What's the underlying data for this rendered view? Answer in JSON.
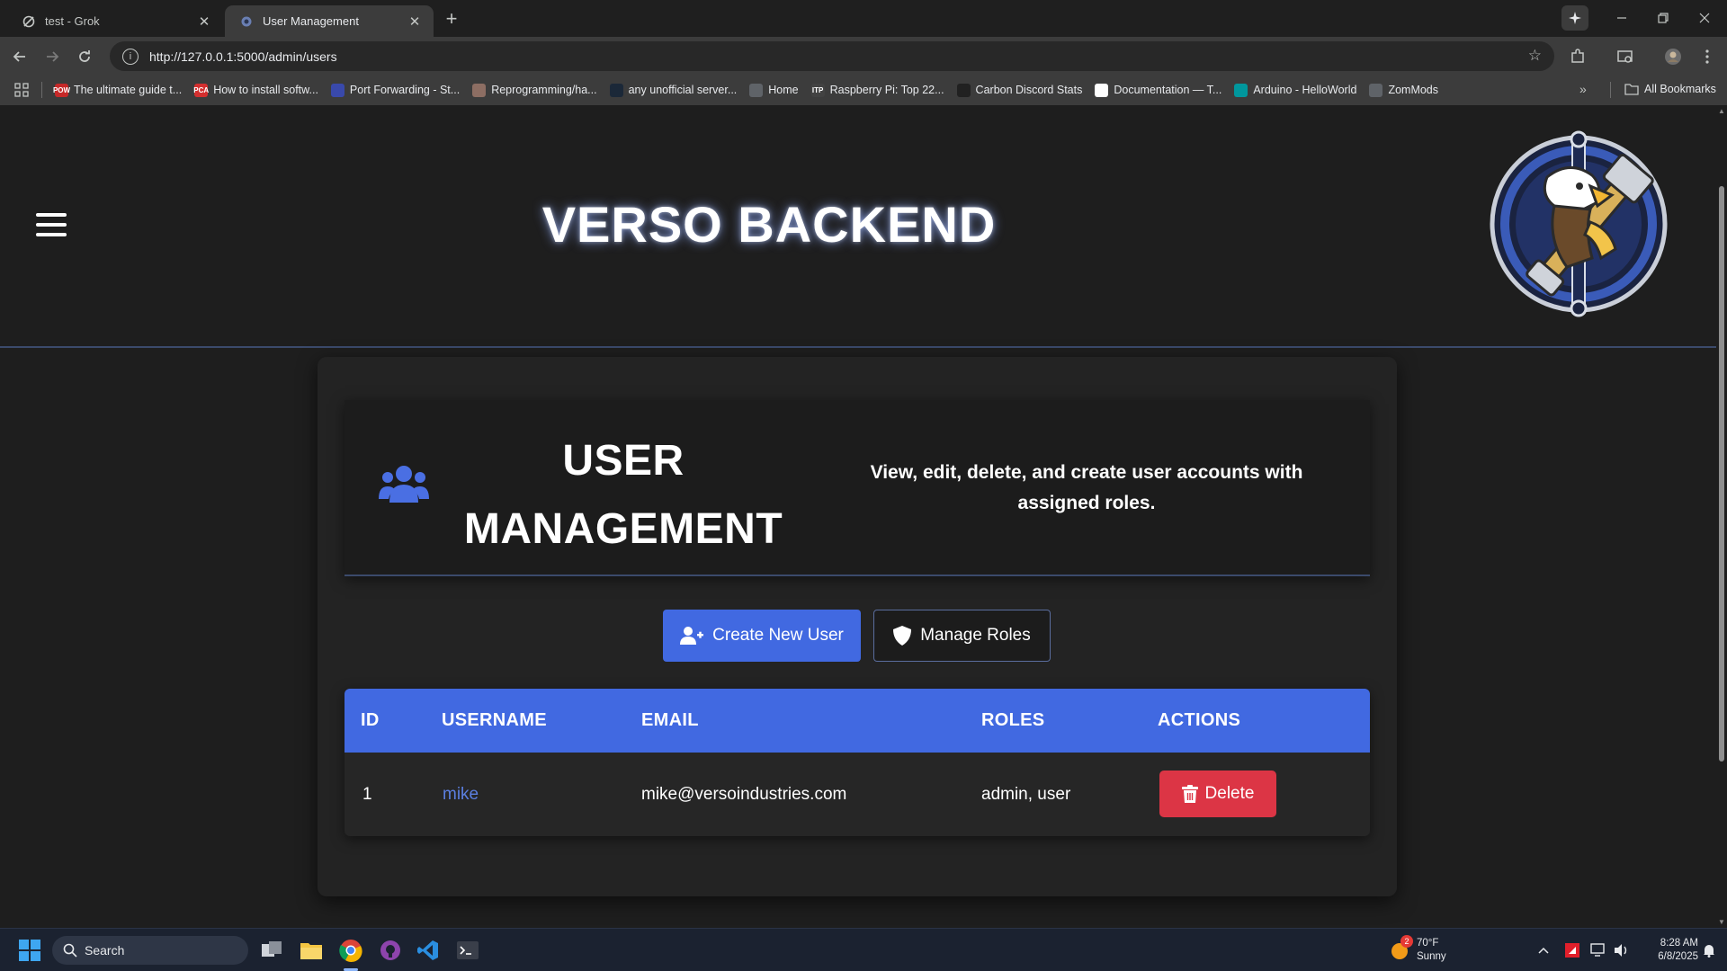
{
  "browser": {
    "tabs": [
      {
        "label": "test - Grok",
        "active": false
      },
      {
        "label": "User Management",
        "active": true
      }
    ],
    "new_tab_label": "+",
    "url": "http://127.0.0.1:5000/admin/users",
    "bookmarks": [
      {
        "label": "The ultimate guide t...",
        "badge": "POW",
        "color": "#c62828"
      },
      {
        "label": "How to install softw...",
        "badge": "PCA",
        "color": "#d32f2f"
      },
      {
        "label": "Port Forwarding - St...",
        "badge": "",
        "color": "#3949ab"
      },
      {
        "label": "Reprogramming/ha...",
        "badge": "",
        "color": "#8d6e63"
      },
      {
        "label": "any unofficial server...",
        "badge": "",
        "color": "#1b2838"
      },
      {
        "label": "Home",
        "badge": "",
        "color": "#5f6368"
      },
      {
        "label": "Raspberry Pi: Top 22...",
        "badge": "ITP",
        "color": "#424242"
      },
      {
        "label": "Carbon Discord Stats",
        "badge": "",
        "color": "#212121"
      },
      {
        "label": "Documentation — T...",
        "badge": "",
        "color": "#ffffff"
      },
      {
        "label": "Arduino - HelloWorld",
        "badge": "",
        "color": "#00979d"
      },
      {
        "label": "ZomMods",
        "badge": "",
        "color": "#5f6368"
      }
    ],
    "all_bookmarks_label": "All Bookmarks"
  },
  "site": {
    "title": "VERSO BACKEND"
  },
  "management": {
    "title": "USER MANAGEMENT",
    "description": "View, edit, delete, and create user accounts with assigned roles.",
    "create_button": "Create New User",
    "roles_button": "Manage Roles"
  },
  "table": {
    "headers": [
      "ID",
      "USERNAME",
      "EMAIL",
      "ROLES",
      "ACTIONS"
    ],
    "rows": [
      {
        "id": "1",
        "username": "mike",
        "email": "mike@versoindustries.com",
        "roles": "admin, user",
        "action": "Delete"
      }
    ]
  },
  "colors": {
    "accent": "#4169e1",
    "danger": "#dc3545",
    "background": "#1e1e1e"
  },
  "taskbar": {
    "search_label": "Search",
    "weather_temp": "70°F",
    "weather_desc": "Sunny",
    "weather_badge": "2",
    "time": "8:28 AM",
    "date": "6/8/2025"
  }
}
